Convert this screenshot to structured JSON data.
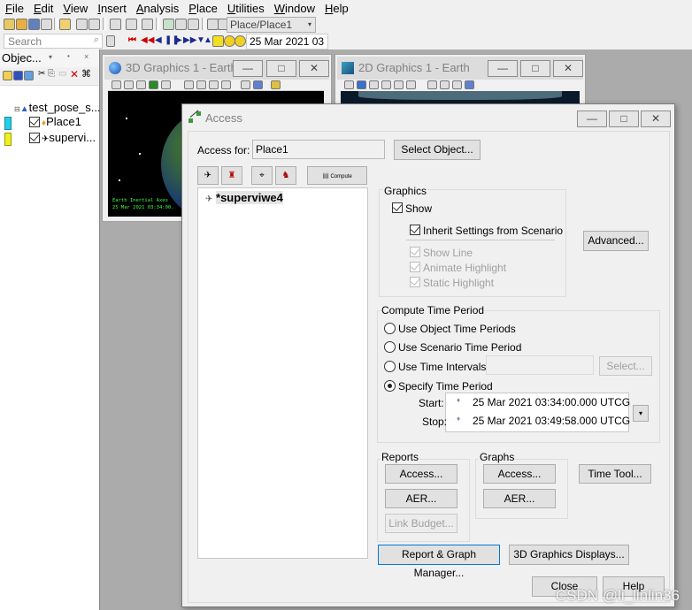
{
  "menu": [
    "File",
    "Edit",
    "View",
    "Insert",
    "Analysis",
    "Place",
    "Utilities",
    "Window",
    "Help"
  ],
  "toolbar": {
    "object_combo": "Place/Place1",
    "search_placeholder": "Search",
    "date_display": "25 Mar 2021 03"
  },
  "object_browser": {
    "title": "Objec...",
    "scenario": "test_pose_s...",
    "items": [
      "Place1",
      "supervi..."
    ]
  },
  "windows": {
    "graphics3d_title": "3D Graphics 1 - Earth",
    "graphics2d_title": "2D Graphics 1 - Earth",
    "axes_label": "Earth Inertial Axes",
    "time_label": "25 Mar 2021 03:34:00."
  },
  "dialog": {
    "title": "Access",
    "access_for_label": "Access for:",
    "access_for_value": "Place1",
    "select_object_btn": "Select Object...",
    "compute_btn": "Compute",
    "target_item": "*superviwe4",
    "graphics": {
      "label": "Graphics",
      "show": "Show",
      "inherit": "Inherit Settings from Scenario",
      "show_line": "Show Line",
      "animate_highlight": "Animate Highlight",
      "static_highlight": "Static Highlight",
      "advanced_btn": "Advanced..."
    },
    "compute_time": {
      "label": "Compute Time Period",
      "opt_object": "Use Object Time Periods",
      "opt_scenario": "Use Scenario Time Period",
      "opt_intervals": "Use Time Intervals",
      "opt_specify": "Specify Time Period",
      "select_btn": "Select...",
      "start_label": "Start:",
      "stop_label": "Stop:",
      "start_value": "25 Mar 2021 03:34:00.000 UTCG",
      "stop_value": "25 Mar 2021 03:49:58.000 UTCG"
    },
    "reports": {
      "label": "Reports",
      "access_btn": "Access...",
      "aer_btn": "AER...",
      "link_budget_btn": "Link Budget..."
    },
    "graphs": {
      "label": "Graphs",
      "access_btn": "Access...",
      "aer_btn": "AER..."
    },
    "time_tool_btn": "Time Tool...",
    "report_graph_mgr_btn": "Report & Graph Manager...",
    "graphics_displays_btn": "3D Graphics Displays...",
    "close_btn": "Close",
    "help_btn": "Help"
  },
  "watermark": "CSDN @li_linlin36"
}
